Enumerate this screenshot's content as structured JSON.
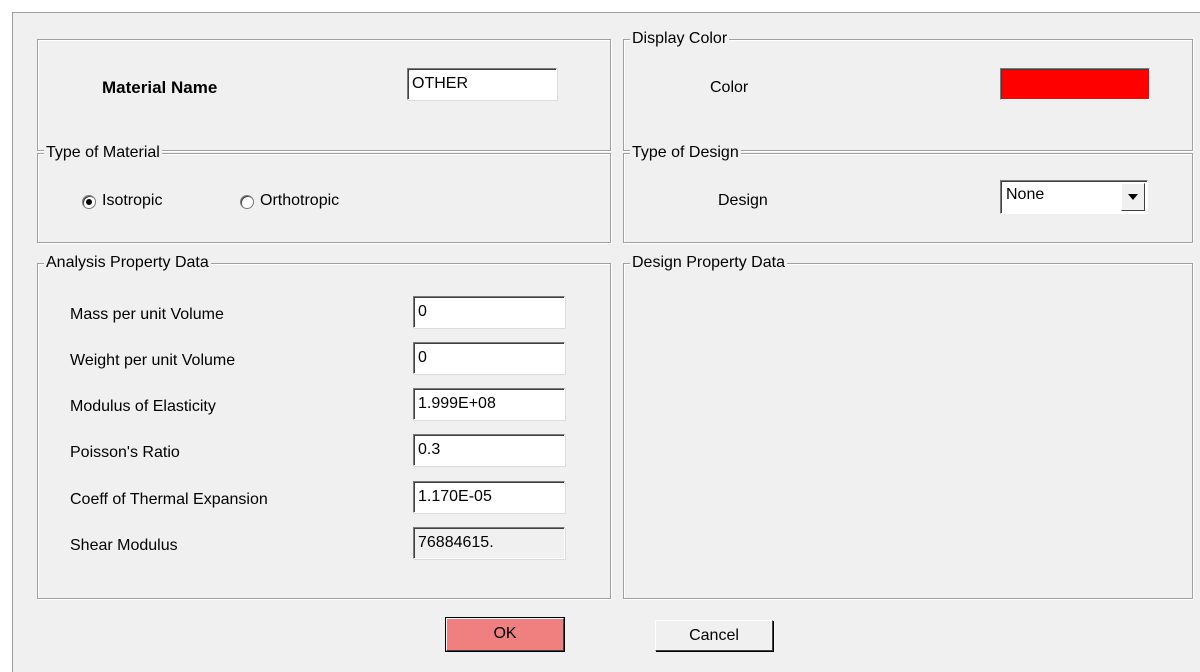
{
  "material_name": {
    "label": "Material Name",
    "value": "OTHER"
  },
  "display_color": {
    "group_title": "Display Color",
    "color_label": "Color",
    "color_value": "#ff0000"
  },
  "type_of_material": {
    "group_title": "Type of Material",
    "options": [
      {
        "label": "Isotropic",
        "selected": true
      },
      {
        "label": "Orthotropic",
        "selected": false
      }
    ]
  },
  "type_of_design": {
    "group_title": "Type of Design",
    "design_label": "Design",
    "selected": "None"
  },
  "analysis_property_data": {
    "group_title": "Analysis Property Data",
    "fields": [
      {
        "label": "Mass per unit Volume",
        "value": "0"
      },
      {
        "label": "Weight per unit Volume",
        "value": "0"
      },
      {
        "label": "Modulus of Elasticity",
        "value": "1.999E+08"
      },
      {
        "label": "Poisson's Ratio",
        "value": "0.3"
      },
      {
        "label": "Coeff of Thermal Expansion",
        "value": "1.170E-05"
      },
      {
        "label": "Shear Modulus",
        "value": "76884615."
      }
    ]
  },
  "design_property_data": {
    "group_title": "Design Property Data"
  },
  "buttons": {
    "ok": "OK",
    "cancel": "Cancel"
  },
  "colors": {
    "ok_button": "#f08080",
    "dialog_bg": "#f0f0f0"
  }
}
